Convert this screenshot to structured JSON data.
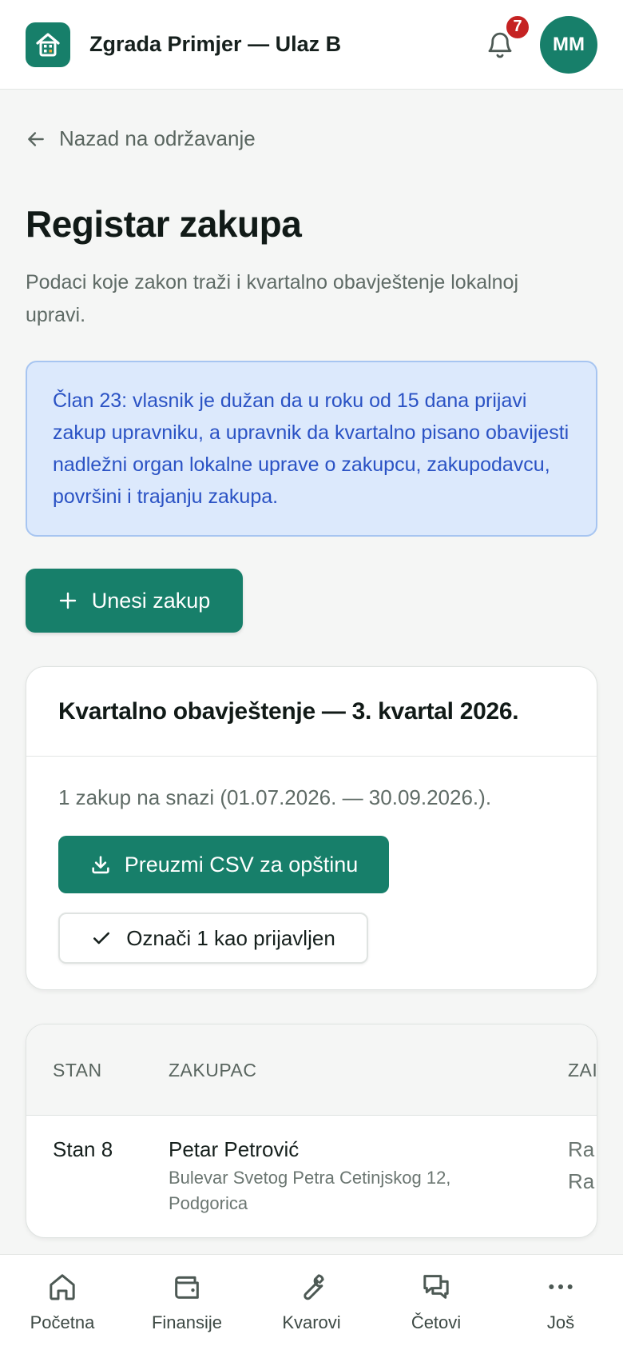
{
  "header": {
    "title": "Zgrada Primjer — Ulaz B",
    "notification_count": "7",
    "avatar_initials": "MM"
  },
  "nav": {
    "back_label": "Nazad na održavanje"
  },
  "page": {
    "title": "Registar zakupa",
    "subtitle": "Podaci koje zakon traži i kvartalno obavještenje lokalnoj upravi.",
    "info": "Član 23: vlasnik je dužan da u roku od 15 dana prijavi zakup upravniku, a upravnik da kvartalno pisano obavijesti nadležni organ lokalne uprave o zakupcu, zakupodavcu, površini i trajanju zakupa.",
    "add_button": "Unesi zakup"
  },
  "quarterly": {
    "title": "Kvartalno obavještenje — 3. kvartal 2026.",
    "summary": "1 zakup na snazi (01.07.2026. — 30.09.2026.).",
    "csv_button": "Preuzmi CSV za opštinu",
    "mark_button": "Označi 1 kao prijavljen"
  },
  "table": {
    "headers": [
      "STAN",
      "ZAKUPAC",
      "ZAI"
    ],
    "rows": [
      {
        "unit": "Stan 8",
        "tenant_name": "Petar Petrović",
        "tenant_address": "Bulevar Svetog Petra Cetinjskog 12, Podgorica",
        "col3": "Ra\nRa"
      }
    ]
  },
  "bottom_nav": [
    {
      "label": "Početna",
      "icon": "home-icon"
    },
    {
      "label": "Finansije",
      "icon": "wallet-icon"
    },
    {
      "label": "Kvarovi",
      "icon": "wrench-icon"
    },
    {
      "label": "Četovi",
      "icon": "chat-icon"
    },
    {
      "label": "Još",
      "icon": "more-icon"
    }
  ],
  "colors": {
    "brand": "#177f6a",
    "badge": "#c52222",
    "info_bg": "#dce9fc",
    "info_text": "#2a52c4"
  }
}
